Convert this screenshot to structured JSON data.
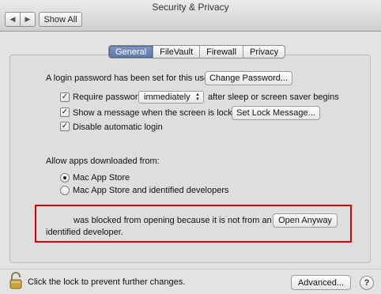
{
  "window": {
    "title": "Security & Privacy",
    "show_all": "Show All",
    "back_glyph": "◀",
    "forward_glyph": "▶"
  },
  "tabs": [
    "General",
    "FileVault",
    "Firewall",
    "Privacy"
  ],
  "selected_tab": "General",
  "general": {
    "login_password_text": "A login password has been set for this user",
    "change_password_button": "Change Password...",
    "require_password": {
      "label": "Require password",
      "checked": true,
      "select_value": "immediately",
      "suffix": "after sleep or screen saver begins"
    },
    "show_message": {
      "label": "Show a message when the screen is locked",
      "checked": true,
      "button": "Set Lock Message..."
    },
    "disable_auto_login": {
      "label": "Disable automatic login",
      "checked": true
    },
    "allow_apps_label": "Allow apps downloaded from:",
    "radio_options": [
      {
        "label": "Mac App Store",
        "selected": true
      },
      {
        "label": "Mac App Store and identified developers",
        "selected": false
      }
    ],
    "blocked_message_line1": "was blocked from opening because it is not from an",
    "blocked_message_line2": "identified developer.",
    "open_anyway_button": "Open Anyway"
  },
  "footer": {
    "lock_text": "Click the lock to prevent further changes.",
    "advanced_button": "Advanced...",
    "help_glyph": "?"
  },
  "colors": {
    "highlight_box": "#d80000",
    "selected_tab": "#6a84b0"
  },
  "icons": {
    "lock": "lock-icon",
    "help": "help-icon",
    "checkmark": "✓"
  }
}
